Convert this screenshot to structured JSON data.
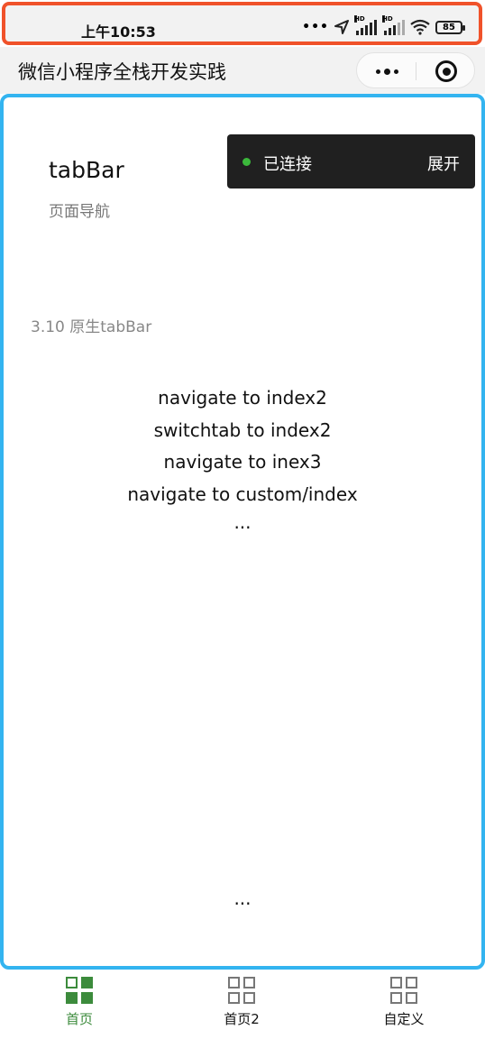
{
  "status_bar": {
    "time": "上午10:53",
    "battery": "85",
    "hd_label": "HD"
  },
  "nav": {
    "title": "微信小程序全栈开发实践"
  },
  "page": {
    "title": "tabBar",
    "subtitle": "页面导航",
    "section": "3.10 原生tabBar",
    "links": [
      "navigate to index2",
      "switchtab to index2",
      "navigate to inex3",
      "navigate to custom/index"
    ],
    "ellipsis": "...",
    "bottom_ellipsis": "..."
  },
  "toast": {
    "status": "已连接",
    "expand": "展开",
    "dot_color": "#3bb83b"
  },
  "tab_bar": {
    "active_color": "#3c8b3c",
    "items": [
      {
        "label": "首页",
        "icon": "grid-icon",
        "active": true
      },
      {
        "label": "首页2",
        "icon": "grid-icon",
        "active": false
      },
      {
        "label": "自定义",
        "icon": "grid-icon",
        "active": false
      }
    ]
  },
  "colors": {
    "status_border": "#f0522a",
    "content_border": "#33b4f0"
  }
}
